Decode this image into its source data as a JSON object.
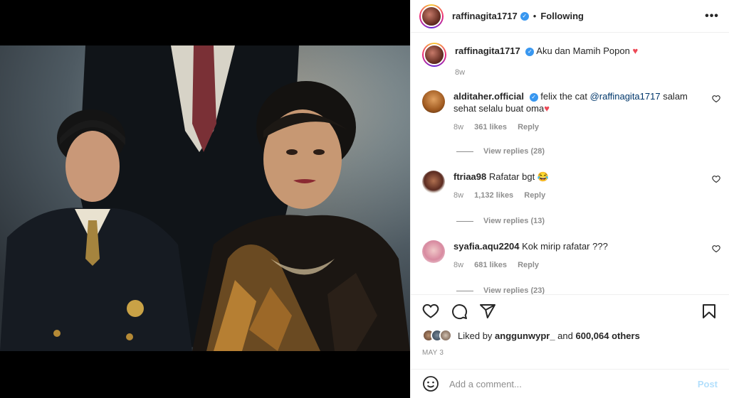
{
  "header": {
    "username": "raffinagita1717",
    "separator": "•",
    "follow_status": "Following",
    "more_label": "•••"
  },
  "caption": {
    "username": "raffinagita1717",
    "text": "Aku dan Mamih Popon",
    "emoji": "♥",
    "time": "8w"
  },
  "comments": [
    {
      "username": "alditaher.official",
      "text_before": "felix the cat ",
      "mention": "@raffinagita1717",
      "text_after": " salam sehat selalu buat oma",
      "emoji": "♥",
      "time": "8w",
      "likes": "361 likes",
      "reply": "Reply",
      "view_replies": "View replies (28)"
    },
    {
      "username": "ftriaa98",
      "text": "Rafatar bgt",
      "emoji": "😂",
      "time": "8w",
      "likes": "1,132 likes",
      "reply": "Reply",
      "view_replies": "View replies (13)"
    },
    {
      "username": "syafia.aqu2204",
      "text": "Kok mirip rafatar ???",
      "time": "8w",
      "likes": "681 likes",
      "reply": "Reply",
      "view_replies": "View replies (23)"
    }
  ],
  "liked_by": {
    "prefix": "Liked by ",
    "user": "anggunwypr_",
    "middle": " and ",
    "others": "600,064 others"
  },
  "post_date": "MAY 3",
  "add_comment": {
    "placeholder": "Add a comment...",
    "post_label": "Post"
  },
  "colors": {
    "accent_link": "#00376b",
    "verified": "#3897f0",
    "heart": "#ed4956",
    "muted": "#8e8e8e",
    "post_disabled": "#b2dffc"
  },
  "icons": [
    "verified-badge-icon",
    "more-options-icon",
    "heart-icon",
    "comment-icon",
    "share-icon",
    "bookmark-icon",
    "emoji-icon"
  ]
}
